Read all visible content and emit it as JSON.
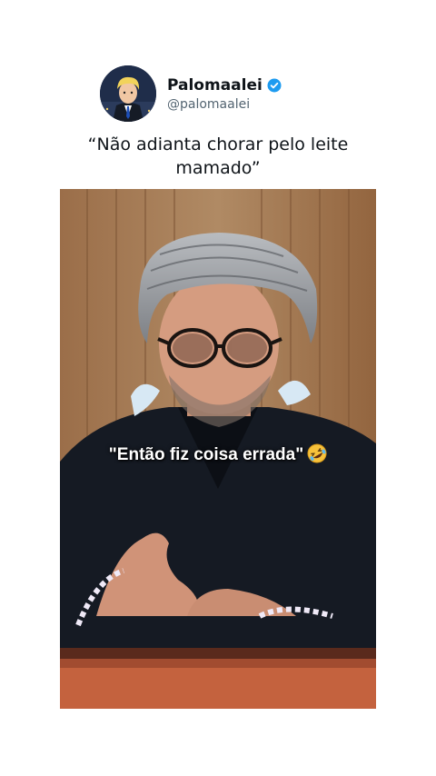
{
  "post": {
    "author_name": "Palomaalei",
    "author_handle": "@palomaalei",
    "verified": true,
    "quote_text": "“Não adianta chorar pelo leite mamado”"
  },
  "video": {
    "caption": "\"Então fiz coisa errada\"",
    "caption_emoji": "rolling-on-floor-laughing-emoji"
  },
  "colors": {
    "verified_badge": "#1d9bf0",
    "background": "#ffffff",
    "text_primary": "#0f1419",
    "text_secondary": "#536471"
  }
}
